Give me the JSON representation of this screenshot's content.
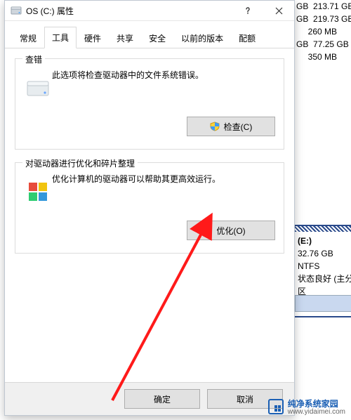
{
  "bg": {
    "rows": [
      {
        "c1": "GB",
        "c2": "213.71 GB"
      },
      {
        "c1": "GB",
        "c2": "219.73 GB"
      },
      {
        "c1": "",
        "c2": "260 MB"
      },
      {
        "c1": "GB",
        "c2": "77.25 GB"
      },
      {
        "c1": "",
        "c2": "350 MB"
      }
    ],
    "panel": {
      "title": "(E:)",
      "size": "32.76 GB NTFS",
      "status": "状态良好 (主分区"
    }
  },
  "dialog": {
    "title": "OS (C:) 属性",
    "tabs": [
      "常规",
      "工具",
      "硬件",
      "共享",
      "安全",
      "以前的版本",
      "配额"
    ],
    "active_tab": 1,
    "group1": {
      "title": "查错",
      "desc": "此选项将检查驱动器中的文件系统错误。",
      "button": "检查(C)"
    },
    "group2": {
      "title": "对驱动器进行优化和碎片整理",
      "desc": "优化计算机的驱动器可以帮助其更高效运行。",
      "button": "优化(O)"
    },
    "ok": "确定",
    "cancel": "取消"
  },
  "watermark": {
    "name": "纯净系统家园",
    "url": "www.yidaimei.com"
  }
}
